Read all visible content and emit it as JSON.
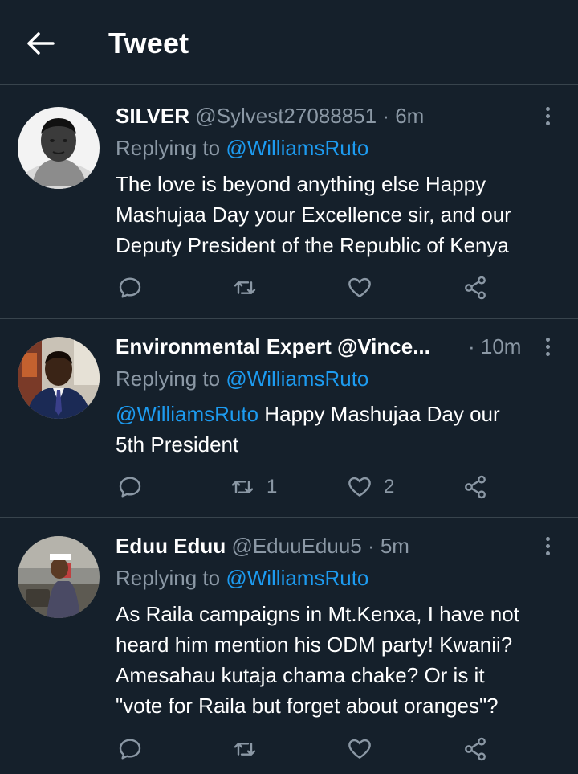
{
  "header": {
    "title": "Tweet"
  },
  "tweets": [
    {
      "name": "SILVER",
      "handle": "@Sylvest27088851",
      "time": "· 6m",
      "replying_prefix": "Replying to ",
      "replying_to": "@WilliamsRuto",
      "lines": [
        "The love is beyond anything else  Happy",
        "Mashujaa Day your Excellence sir, and our",
        "Deputy President of the Republic of Kenya"
      ]
    },
    {
      "name": "Environmental Expert @Vince...",
      "time": "· 10m",
      "replying_prefix": "Replying to ",
      "replying_to": "@WilliamsRuto",
      "mention": "@WilliamsRuto",
      "line1_rest": " Happy Mashujaa Day our",
      "line2": "5th President",
      "retweets": "1",
      "likes": "2"
    },
    {
      "name": "Eduu Eduu",
      "handle": "@EduuEduu5",
      "time": "· 5m",
      "replying_prefix": "Replying to ",
      "replying_to": "@WilliamsRuto",
      "lines": [
        "As Raila campaigns in Mt.Kenxa, I have not",
        "heard him mention  his ODM party! Kwanii?",
        "Amesahau kutaja chama chake? Or is it",
        "\"vote for Raila but forget about oranges\"?"
      ]
    }
  ],
  "colors": {
    "background": "#15202b",
    "divider": "#38444d",
    "secondary_text": "#8b98a5",
    "accent": "#1d9bf0"
  },
  "icons": [
    "back-arrow-icon",
    "more-vertical-icon",
    "reply-icon",
    "retweet-icon",
    "like-icon",
    "share-icon"
  ]
}
